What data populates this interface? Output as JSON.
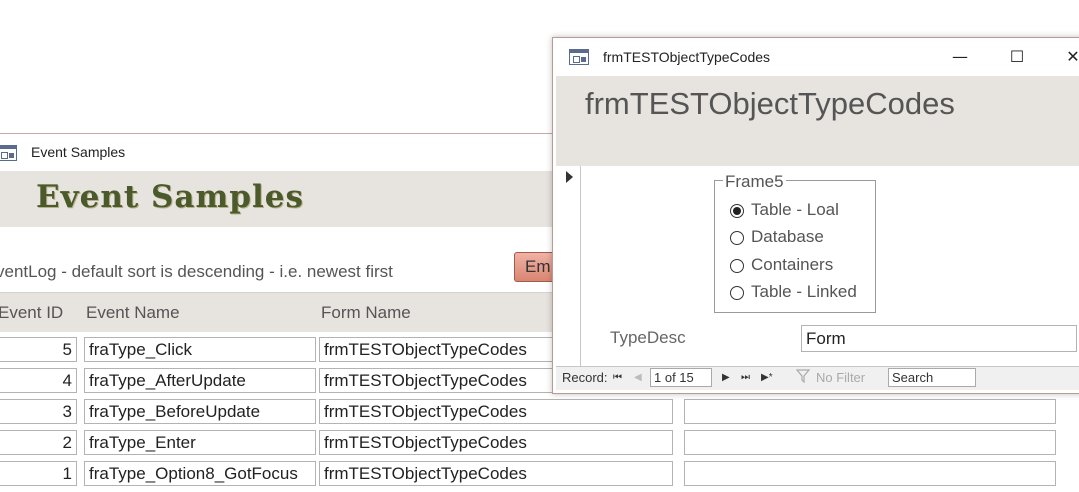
{
  "events_window": {
    "title": "Event Samples",
    "header_title": "Event Samples",
    "sort_note": "ventLog - default sort is descending - i.e. newest first",
    "button_label": "Em",
    "columns": [
      "Event ID",
      "Event Name",
      "Form Name"
    ],
    "rows": [
      {
        "event_id": "5",
        "event_name": "fraType_Click",
        "form_name": "frmTESTObjectTypeCodes",
        "extra": ""
      },
      {
        "event_id": "4",
        "event_name": "fraType_AfterUpdate",
        "form_name": "frmTESTObjectTypeCodes",
        "extra": ""
      },
      {
        "event_id": "3",
        "event_name": "fraType_BeforeUpdate",
        "form_name": "frmTESTObjectTypeCodes",
        "extra": ""
      },
      {
        "event_id": "2",
        "event_name": "fraType_Enter",
        "form_name": "frmTESTObjectTypeCodes",
        "extra": ""
      },
      {
        "event_id": "1",
        "event_name": "fraType_Option8_GotFocus",
        "form_name": "frmTESTObjectTypeCodes",
        "extra": ""
      }
    ]
  },
  "codes_window": {
    "title": "frmTESTObjectTypeCodes",
    "header_title": "frmTESTObjectTypeCodes",
    "window_buttons": {
      "minimize": "—",
      "maximize": "☐",
      "close": "✕"
    },
    "frame": {
      "legend": "Frame5",
      "options": [
        {
          "label": "Table - Loal",
          "selected": true
        },
        {
          "label": "Database",
          "selected": false
        },
        {
          "label": "Containers",
          "selected": false
        },
        {
          "label": "Table - Linked",
          "selected": false
        }
      ]
    },
    "typedesc_label": "TypeDesc",
    "typedesc_value": "Form",
    "nav": {
      "record_label": "Record:",
      "first": "⏮",
      "prev": "◀",
      "current": "1 of 15",
      "next": "▶",
      "last": "⏭",
      "new": "▶*",
      "filter_label": "No Filter",
      "search_value": "Search"
    }
  },
  "colors": {
    "header_bg": "#e7e3df",
    "title_green": "#4a5a2a",
    "button_salmon": "#e09a88"
  }
}
